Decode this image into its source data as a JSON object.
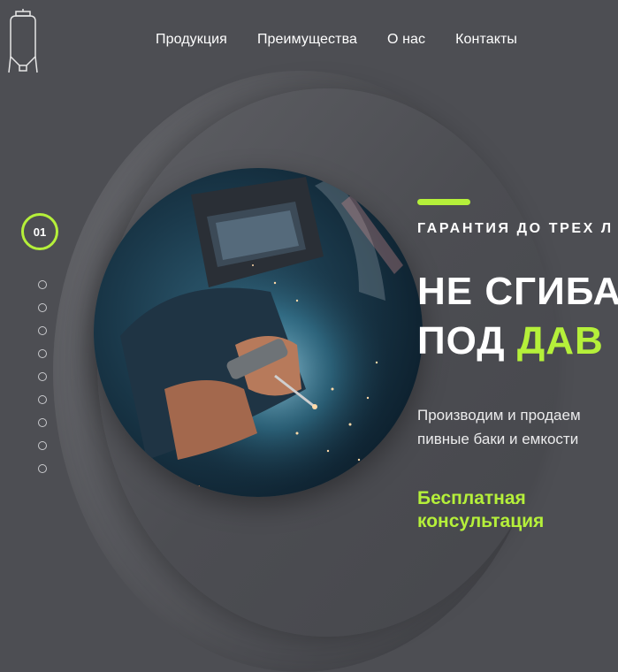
{
  "nav": {
    "items": [
      {
        "label": "Продукция"
      },
      {
        "label": "Преимущества"
      },
      {
        "label": "О нас"
      },
      {
        "label": "Контакты"
      }
    ]
  },
  "slider": {
    "active_label": "01",
    "dot_count": 9
  },
  "hero": {
    "subtitle": "ГАРАНТИЯ ДО ТРЕХ Л",
    "headline_line1": "НЕ СГИБА",
    "headline_line2_prefix": "ПОД ",
    "headline_line2_accent": "ДАВ",
    "description_line1": "Производим и продаем",
    "description_line2": "пивные баки и емкости",
    "cta_line1": "Бесплатная",
    "cta_line2": "консультация"
  },
  "colors": {
    "background": "#4d4e53",
    "accent": "#b5f03a",
    "text": "#ffffff"
  },
  "icons": {
    "logo": "brewing-tank-icon"
  }
}
